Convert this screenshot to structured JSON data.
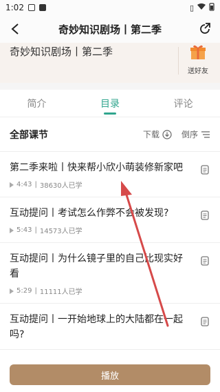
{
  "status": {
    "time": "1:02"
  },
  "nav": {
    "title": "奇妙知识剧场丨第二季"
  },
  "header": {
    "title": "奇妙知识剧场丨第二季",
    "gift_label": "送好友"
  },
  "tabs": [
    {
      "label": "简介"
    },
    {
      "label": "目录"
    },
    {
      "label": "评论"
    }
  ],
  "section": {
    "title": "全部课节",
    "download_label": "下载",
    "sort_label": "倒序"
  },
  "lessons": [
    {
      "title": "第二季来啦丨快来帮小欣小萌装修新家吧",
      "duration": "4:43",
      "learners": "38630人已学"
    },
    {
      "title": "互动提问丨考试怎么作弊不会被发现?",
      "duration": "5:43",
      "learners": "14573人已学"
    },
    {
      "title": "互动提问丨为什么镜子里的自己比现实好看",
      "duration": "5:29",
      "learners": "11111人已学"
    },
    {
      "title": "互动提问丨一开始地球上的大陆都在一起吗?",
      "duration": "",
      "learners": ""
    }
  ],
  "play_button": {
    "label": "播放"
  },
  "colors": {
    "accent": "#2fa58d",
    "play": "#b28c67",
    "annotation_arrow": "#d64a4a"
  }
}
